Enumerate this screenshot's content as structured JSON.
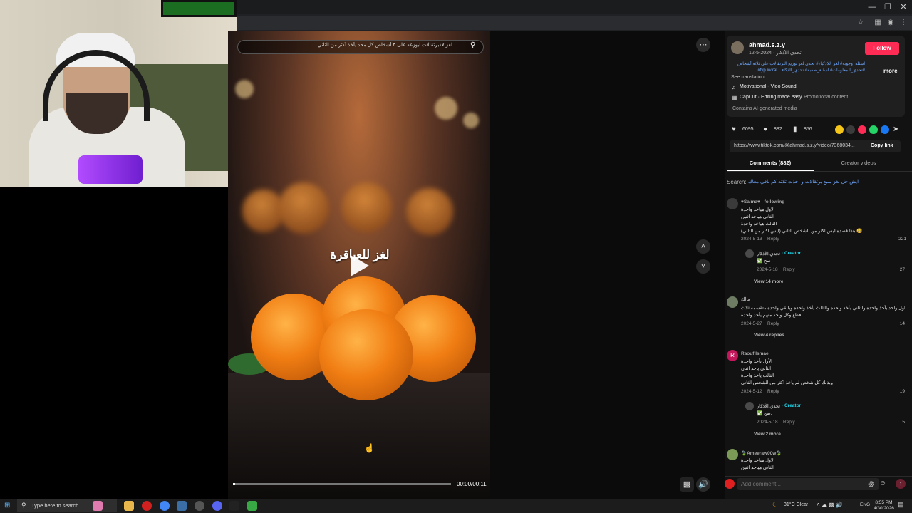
{
  "video": {
    "search_text": "لغز ١٧برتقالات ابوزعه على ٣ أشخاص كل محد يأخذ أكثر من الثاني",
    "title": "لغز للعباقرة",
    "timecode": "00:00/00:11",
    "progress_fraction": 0.01
  },
  "post": {
    "username": "ahmad.s.z.y",
    "user_meta": "تحدي الأذكار · 2024-5-12",
    "follow_label": "Follow",
    "description": "اسئلة_وجوبة# لغز_للاذكياء# تحدي لغز توزيع البرتقالات على ثلاثة أشخاص #fyp #viral... تحدي_المعلومات# اسئلة_صعبة# تحدي_الذكاء#",
    "more_label": "more",
    "see_translation": "See translation",
    "music": "Motivational - Vioo Sound",
    "capcut": "CapCut · Editing made easy",
    "promotional": "Promotional content",
    "ai_generated": "Contains AI-generated media",
    "likes": "6095",
    "comments": "882",
    "saves": "856",
    "link_url": "https://www.tiktok.com/@ahmad.s.z.y/video/7368034...",
    "copy_link": "Copy link",
    "tab_comments": "Comments (882)",
    "tab_creator": "Creator videos",
    "search_label": "Search:",
    "search_query": "ايش حل لغز سبع برتقالات و اخذت ثلاثه كم باقي معاك"
  },
  "comments": [
    {
      "name": "♥Salma♥ · following",
      "lines": [
        "الاول هياخد واحدة",
        "الثاني هياخد اثنين",
        "الثالث هياخد واحدة",
        "(ليس اكثر من الثاني) هذا قصده ليس اكثر من الشخص الثاني 😅"
      ],
      "date": "2024-5-13",
      "reply": "Reply",
      "likes": "221",
      "sub": {
        "name": "تحدي الأذكار",
        "creator": "· Creator",
        "line": "✅ صح",
        "date": "2024-5-18",
        "reply": "Reply",
        "likes": "27"
      },
      "view_more": "View 14 more"
    },
    {
      "name": "مالك",
      "lines": [
        "اول واحد يأخذ واحده والثاني يأخذ واحده والثالث يأخذ واحده وبالقي واحده متقسمه ثلاث",
        "قطع وكل واحد منهم يأخذ واحده"
      ],
      "date": "2024-5-27",
      "reply": "Reply",
      "likes": "14",
      "view_more": "View 4 replies"
    },
    {
      "name": "Raouf Ismael",
      "lines": [
        "الأول يأخذ واحدة",
        "الثاني يأخذ اثنان",
        "الثالث يأخذ واحدة",
        "وبذلك كل شخص لم يأخذ اكثر من الشخص الثاني"
      ],
      "date": "2024-5-12",
      "reply": "Reply",
      "likes": "19",
      "sub": {
        "name": "تحدي الأذكار",
        "creator": "· Creator",
        "line": "✅ صح.",
        "date": "2024-5-18",
        "reply": "Reply",
        "likes": "5"
      },
      "view_more": "View 2 more"
    },
    {
      "name": "🍃Ameeraw00w🍃",
      "lines": [
        "الاول هياخد واحدة",
        "الثاني هياخد اثنين"
      ]
    }
  ],
  "comment_bar": {
    "placeholder": "Add comment..."
  },
  "taskbar": {
    "search_placeholder": "Type here to search",
    "weather": "31°C  Clear",
    "lang": "ENG",
    "time": "8:55 PM",
    "date": "4/30/2026"
  }
}
